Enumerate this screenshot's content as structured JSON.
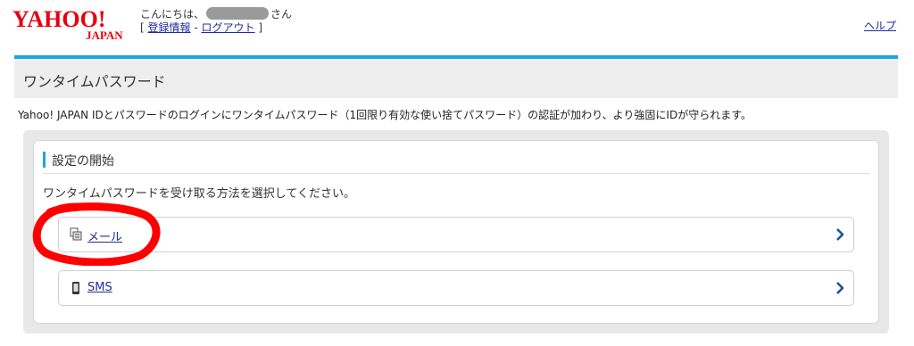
{
  "header": {
    "logo_text": "YAHOO!",
    "logo_sub": "JAPAN",
    "greeting_prefix": "こんにちは、",
    "greeting_suffix": "さん",
    "account_info_link": "登録情報",
    "separator": "-",
    "logout_link": "ログアウト",
    "help_link": "ヘルプ"
  },
  "page": {
    "title": "ワンタイムパスワード",
    "description": "Yahoo! JAPAN IDとパスワードのログインにワンタイムパスワード（1回限り有効な使い捨てパスワード）の認証が加わり、より強固にIDが守られます。"
  },
  "settings": {
    "heading": "設定の開始",
    "instructions": "ワンタイムパスワードを受け取る方法を選択してください。",
    "options": [
      {
        "label": "メール",
        "icon": "mail-icon"
      },
      {
        "label": "SMS",
        "icon": "phone-icon"
      }
    ]
  },
  "colors": {
    "accent": "#1da3e3",
    "link": "#1e2d9c",
    "brand_red": "#e60012"
  }
}
